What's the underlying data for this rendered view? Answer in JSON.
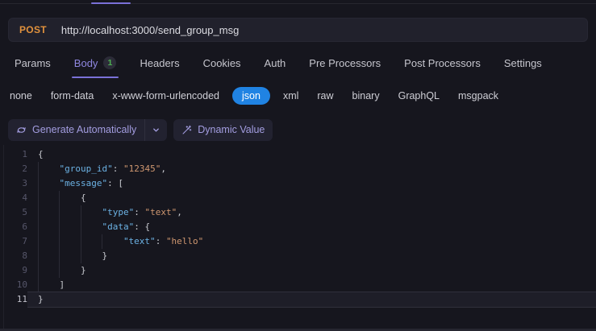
{
  "request_bar": {
    "method": "POST",
    "url": "http://localhost:3000/send_group_msg"
  },
  "tabs": [
    {
      "label": "Params",
      "active": false,
      "badge": null
    },
    {
      "label": "Body",
      "active": true,
      "badge": "1"
    },
    {
      "label": "Headers",
      "active": false,
      "badge": null
    },
    {
      "label": "Cookies",
      "active": false,
      "badge": null
    },
    {
      "label": "Auth",
      "active": false,
      "badge": null
    },
    {
      "label": "Pre Processors",
      "active": false,
      "badge": null
    },
    {
      "label": "Post Processors",
      "active": false,
      "badge": null
    },
    {
      "label": "Settings",
      "active": false,
      "badge": null
    }
  ],
  "body_types": [
    {
      "label": "none",
      "active": false
    },
    {
      "label": "form-data",
      "active": false
    },
    {
      "label": "x-www-form-urlencoded",
      "active": false
    },
    {
      "label": "json",
      "active": true
    },
    {
      "label": "xml",
      "active": false
    },
    {
      "label": "raw",
      "active": false
    },
    {
      "label": "binary",
      "active": false
    },
    {
      "label": "GraphQL",
      "active": false
    },
    {
      "label": "msgpack",
      "active": false
    }
  ],
  "toolbar": {
    "generate_label": "Generate Automatically",
    "dynamic_label": "Dynamic Value"
  },
  "icons": {
    "generate": "sync-icon",
    "generate_menu": "chevron-down-icon",
    "dynamic": "wand-icon"
  },
  "editor": {
    "language": "json",
    "lines": [
      {
        "n": "1",
        "indent": 0,
        "active": false,
        "tokens": [
          [
            "p",
            "{"
          ]
        ]
      },
      {
        "n": "2",
        "indent": 1,
        "active": false,
        "tokens": [
          [
            "k",
            "\"group_id\""
          ],
          [
            "p",
            ": "
          ],
          [
            "s",
            "\"12345\""
          ],
          [
            "p",
            ","
          ]
        ]
      },
      {
        "n": "3",
        "indent": 1,
        "active": false,
        "tokens": [
          [
            "k",
            "\"message\""
          ],
          [
            "p",
            ": ["
          ]
        ]
      },
      {
        "n": "4",
        "indent": 2,
        "active": false,
        "tokens": [
          [
            "p",
            "{"
          ]
        ]
      },
      {
        "n": "5",
        "indent": 3,
        "active": false,
        "tokens": [
          [
            "k",
            "\"type\""
          ],
          [
            "p",
            ": "
          ],
          [
            "s",
            "\"text\""
          ],
          [
            "p",
            ","
          ]
        ]
      },
      {
        "n": "6",
        "indent": 3,
        "active": false,
        "tokens": [
          [
            "k",
            "\"data\""
          ],
          [
            "p",
            ": {"
          ]
        ]
      },
      {
        "n": "7",
        "indent": 4,
        "active": false,
        "tokens": [
          [
            "k",
            "\"text\""
          ],
          [
            "p",
            ": "
          ],
          [
            "s",
            "\"hello\""
          ]
        ]
      },
      {
        "n": "8",
        "indent": 3,
        "active": false,
        "tokens": [
          [
            "p",
            "}"
          ]
        ]
      },
      {
        "n": "9",
        "indent": 2,
        "active": false,
        "tokens": [
          [
            "p",
            "}"
          ]
        ]
      },
      {
        "n": "10",
        "indent": 1,
        "active": false,
        "tokens": [
          [
            "p",
            "]"
          ]
        ]
      },
      {
        "n": "11",
        "indent": 0,
        "active": true,
        "tokens": [
          [
            "p",
            "}"
          ]
        ]
      }
    ]
  },
  "colors": {
    "accent_purple": "#7a71d8",
    "tab_active_purple": "#8f87e0",
    "method_orange": "#e2923d",
    "badge_green": "#4db052",
    "json_pill_blue": "#2083e3",
    "key_blue": "#6cb2e4",
    "string_orange": "#cf9770",
    "background": "#16161e"
  }
}
